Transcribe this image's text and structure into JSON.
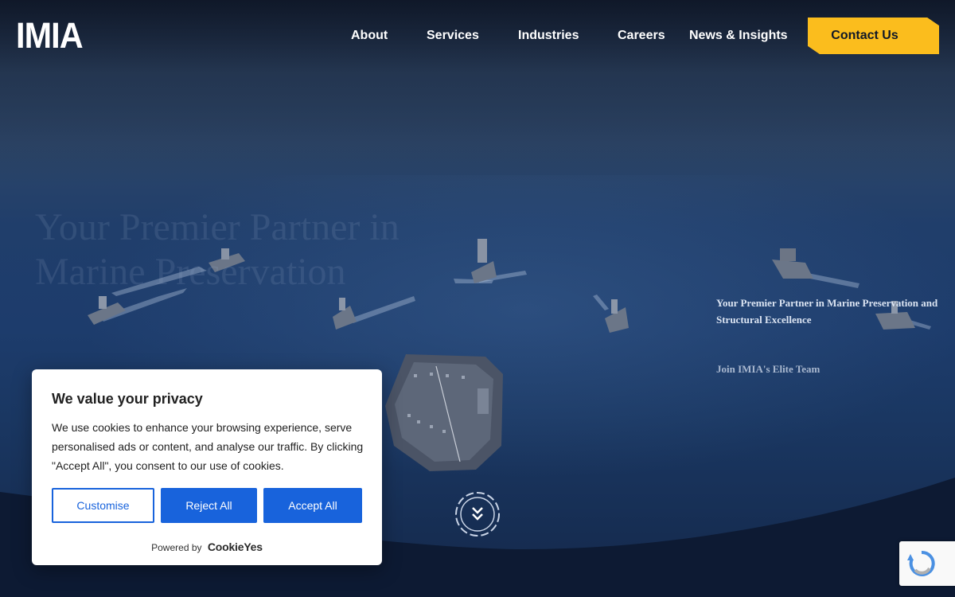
{
  "brand": {
    "logo_text": "IMIA"
  },
  "nav": {
    "items": [
      {
        "label": "About"
      },
      {
        "label": "Services"
      },
      {
        "label": "Industries"
      },
      {
        "label": "Careers"
      },
      {
        "label": "News & Insights"
      }
    ],
    "cta_label": "Contact Us",
    "cta_color": "#fbbd1d"
  },
  "hero": {
    "title": "Your Premier Partner in Marine Preservation",
    "side_tagline": "Your Premier Partner in Marine Preservation and Structural Excellence",
    "side_link": "Join IMIA's Elite Team",
    "scroll_icon": "double-chevron-down-icon"
  },
  "cookie_banner": {
    "title": "We value your privacy",
    "body": "We use cookies to enhance your browsing experience, serve personalised ads or content, and analyse our traffic. By clicking \"Accept All\", you consent to our use of cookies.",
    "customise_label": "Customise",
    "reject_label": "Reject All",
    "accept_label": "Accept All",
    "powered_by": "Powered by",
    "powered_brand": "CookieYes",
    "accent_color": "#1863dc"
  },
  "recaptcha": {
    "icon": "recaptcha-icon"
  }
}
